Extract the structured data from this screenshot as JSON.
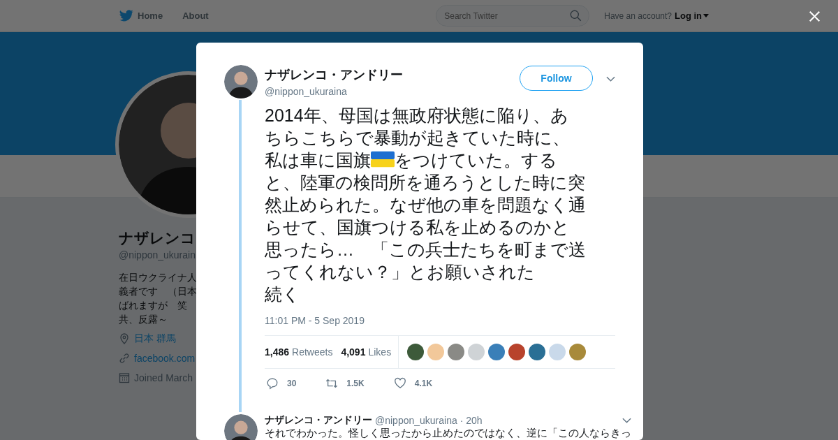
{
  "nav": {
    "home": "Home",
    "about": "About",
    "search_placeholder": "Search Twitter",
    "account_prompt": "Have an account?",
    "login": "Log in"
  },
  "profile": {
    "name": "ナザレンコ",
    "handle": "@nippon_ukurain",
    "bio": [
      "在日ウクライナ人",
      "義者です　（日本",
      "ばれますが　笑",
      "共、反露～"
    ],
    "location": "日本 群馬",
    "link": "facebook.com",
    "joined": "Joined March"
  },
  "tweet": {
    "name": "ナザレンコ・アンドリー",
    "handle": "@nippon_ukuraina",
    "follow": "Follow",
    "lines": [
      [
        {
          "kind": "text",
          "text": "2014年、母国は無政府状態に陥り、あ"
        }
      ],
      [
        {
          "kind": "text",
          "text": "ちらこちらで暴動が起きていた時に、"
        }
      ],
      [
        {
          "kind": "text",
          "text": "私は車に国旗"
        },
        {
          "kind": "flag"
        },
        {
          "kind": "text",
          "text": "をつけていた。する"
        }
      ],
      [
        {
          "kind": "text",
          "text": "と、陸軍の検問所を通ろうとした時に突"
        }
      ],
      [
        {
          "kind": "text",
          "text": "然止められた。なぜ他の車を問題なく通"
        }
      ],
      [
        {
          "kind": "text",
          "text": "らせて、国旗つける私を止めるのかと"
        }
      ],
      [
        {
          "kind": "text",
          "text": "思ったら…　「この兵士たちを町まで送"
        }
      ],
      [
        {
          "kind": "text",
          "text": "ってくれない？」とお願いされた"
        }
      ],
      [
        {
          "kind": "text",
          "text": "続く"
        }
      ]
    ],
    "time": "11:01 PM - 5 Sep 2019",
    "retweets_count": "1,486",
    "retweets_label": "Retweets",
    "likes_count": "4,091",
    "likes_label": "Likes",
    "likers": [
      {
        "color": "#3d5a3a"
      },
      {
        "color": "#f2c89a"
      },
      {
        "color": "#8a8a86"
      },
      {
        "color": "#cfd3d6"
      },
      {
        "color": "#3a7fb8"
      },
      {
        "color": "#b8432c"
      },
      {
        "color": "#2a6f95"
      },
      {
        "color": "#c9d9ea"
      },
      {
        "color": "#a88a3a"
      }
    ],
    "replies": "30",
    "retweets_short": "1.5K",
    "likes_short": "4.1K"
  },
  "reply": {
    "name": "ナザレンコ・アンドリー",
    "handle": "@nippon_ukuraina",
    "time": "· 20h",
    "text": "それでわかった。怪しく思ったから止めたのではなく、逆に「この人ならきっ"
  }
}
